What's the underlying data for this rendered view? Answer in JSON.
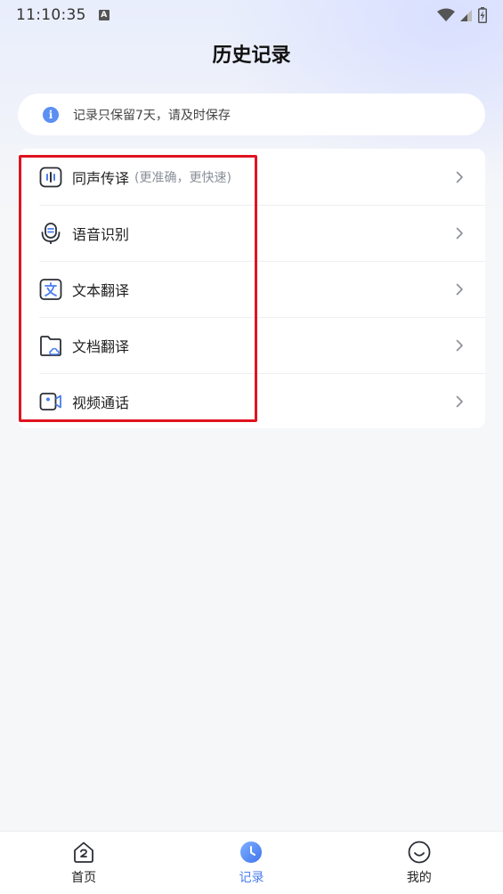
{
  "status_bar": {
    "time": "11:10:35",
    "notif_letter": "A"
  },
  "header": {
    "title": "历史记录"
  },
  "notice": {
    "text": "记录只保留7天，请及时保存"
  },
  "list": {
    "items": [
      {
        "label": "同声传译",
        "sub": "(更准确，更快速)",
        "icon": "simultaneous-interpretation-icon"
      },
      {
        "label": "语音识别",
        "sub": "",
        "icon": "microphone-icon"
      },
      {
        "label": "文本翻译",
        "sub": "",
        "icon": "text-translate-icon"
      },
      {
        "label": "文档翻译",
        "sub": "",
        "icon": "document-folder-icon"
      },
      {
        "label": "视频通话",
        "sub": "",
        "icon": "video-call-icon"
      }
    ]
  },
  "tabbar": {
    "tabs": [
      {
        "label": "首页",
        "icon": "home-icon",
        "active": false
      },
      {
        "label": "记录",
        "icon": "clock-icon",
        "active": true
      },
      {
        "label": "我的",
        "icon": "smiley-icon",
        "active": false
      }
    ]
  },
  "colors": {
    "accent": "#4b7ef0",
    "highlight": "#e0141f",
    "info": "#5b8ff3"
  }
}
